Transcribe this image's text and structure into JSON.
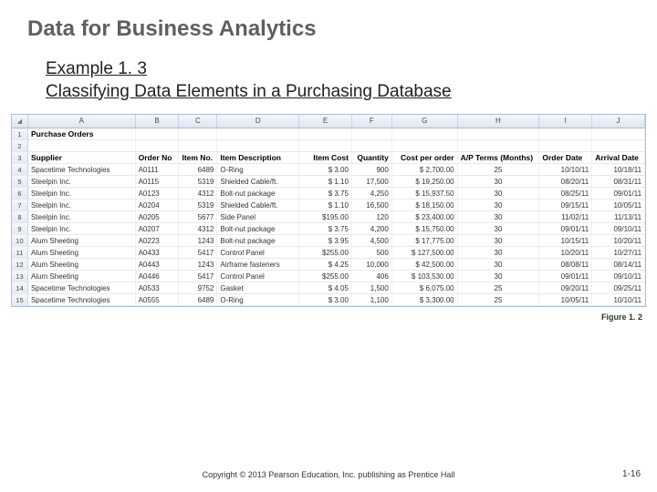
{
  "title": "Data for Business Analytics",
  "subtitle_line1": "Example 1. 3",
  "subtitle_line2": "Classifying Data Elements in a Purchasing Database",
  "figure_caption": "Figure 1. 2",
  "copyright": "Copyright © 2013 Pearson Education, Inc. publishing as Prentice Hall",
  "page_number": "1-16",
  "spreadsheet": {
    "column_letters": [
      "A",
      "B",
      "C",
      "D",
      "E",
      "F",
      "G",
      "H",
      "I",
      "J"
    ],
    "row1_a": "Purchase Orders",
    "headers": {
      "a": "Supplier",
      "b": "Order No",
      "c": "Item No.",
      "d": "Item Description",
      "e": "Item Cost",
      "f": "Quantity",
      "g": "Cost per order",
      "h": "A/P Terms (Months)",
      "i": "Order Date",
      "j": "Arrival Date"
    },
    "rows": [
      {
        "n": "4",
        "a": "Spacetime Technologies",
        "b": "A0111",
        "c": "6489",
        "d": "O-Ring",
        "e": "$ 3.00",
        "f": "900",
        "g": "$ 2,700.00",
        "h": "25",
        "i": "10/10/11",
        "j": "10/18/11"
      },
      {
        "n": "5",
        "a": "Steelpin Inc.",
        "b": "A0115",
        "c": "5319",
        "d": "Shielded Cable/ft.",
        "e": "$ 1.10",
        "f": "17,500",
        "g": "$ 19,250.00",
        "h": "30",
        "i": "08/20/11",
        "j": "08/31/11"
      },
      {
        "n": "6",
        "a": "Steelpin Inc.",
        "b": "A0123",
        "c": "4312",
        "d": "Bolt-nut package",
        "e": "$ 3.75",
        "f": "4,250",
        "g": "$ 15,937.50",
        "h": "30",
        "i": "08/25/11",
        "j": "09/01/11"
      },
      {
        "n": "7",
        "a": "Steelpin Inc.",
        "b": "A0204",
        "c": "5319",
        "d": "Shielded Cable/ft.",
        "e": "$ 1.10",
        "f": "16,500",
        "g": "$ 18,150.00",
        "h": "30",
        "i": "09/15/11",
        "j": "10/05/11"
      },
      {
        "n": "8",
        "a": "Steelpin Inc.",
        "b": "A0205",
        "c": "5677",
        "d": "Side Panel",
        "e": "$195.00",
        "f": "120",
        "g": "$ 23,400.00",
        "h": "30",
        "i": "11/02/11",
        "j": "11/13/11"
      },
      {
        "n": "9",
        "a": "Steelpin Inc.",
        "b": "A0207",
        "c": "4312",
        "d": "Bolt-nut package",
        "e": "$ 3.75",
        "f": "4,200",
        "g": "$ 15,750.00",
        "h": "30",
        "i": "09/01/11",
        "j": "09/10/11"
      },
      {
        "n": "10",
        "a": "Alum Sheeting",
        "b": "A0223",
        "c": "1243",
        "d": "Bolt-nut package",
        "e": "$ 3.95",
        "f": "4,500",
        "g": "$ 17,775.00",
        "h": "30",
        "i": "10/15/11",
        "j": "10/20/11"
      },
      {
        "n": "11",
        "a": "Alum Sheeting",
        "b": "A0433",
        "c": "5417",
        "d": "Control Panel",
        "e": "$255.00",
        "f": "500",
        "g": "$ 127,500.00",
        "h": "30",
        "i": "10/20/11",
        "j": "10/27/11"
      },
      {
        "n": "12",
        "a": "Alum Sheeting",
        "b": "A0443",
        "c": "1243",
        "d": "Airframe fasteners",
        "e": "$ 4.25",
        "f": "10,000",
        "g": "$ 42,500.00",
        "h": "30",
        "i": "08/08/11",
        "j": "08/14/11"
      },
      {
        "n": "13",
        "a": "Alum Sheeting",
        "b": "A0446",
        "c": "5417",
        "d": "Control Panel",
        "e": "$255.00",
        "f": "406",
        "g": "$ 103,530.00",
        "h": "30",
        "i": "09/01/11",
        "j": "09/10/11"
      },
      {
        "n": "14",
        "a": "Spacetime Technologies",
        "b": "A0533",
        "c": "9752",
        "d": "Gasket",
        "e": "$ 4.05",
        "f": "1,500",
        "g": "$ 6,075.00",
        "h": "25",
        "i": "09/20/11",
        "j": "09/25/11"
      },
      {
        "n": "15",
        "a": "Spacetime Technologies",
        "b": "A0555",
        "c": "6489",
        "d": "O-Ring",
        "e": "$ 3.00",
        "f": "1,100",
        "g": "$ 3,300.00",
        "h": "25",
        "i": "10/05/11",
        "j": "10/10/11"
      }
    ]
  }
}
